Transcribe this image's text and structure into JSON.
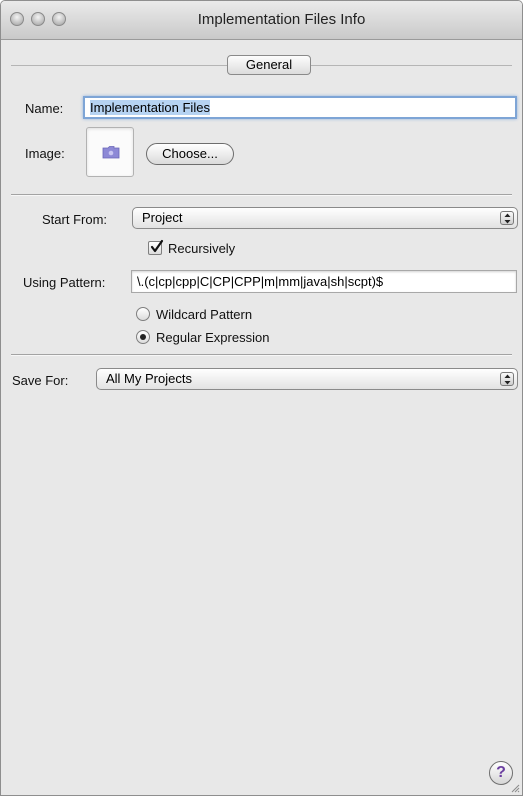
{
  "window": {
    "title": "Implementation Files Info"
  },
  "tabs": {
    "general_label": "General"
  },
  "form": {
    "name_label": "Name:",
    "name_value": "Implementation Files",
    "image_label": "Image:",
    "choose_button": "Choose...",
    "start_from_label": "Start From:",
    "start_from_value": "Project",
    "recursively_label": "Recursively",
    "recursively_checked": true,
    "using_pattern_label": "Using Pattern:",
    "using_pattern_value": "\\.(c|cp|cpp|C|CP|CPP|m|mm|java|sh|scpt)$",
    "wildcard_label": "Wildcard Pattern",
    "regex_label": "Regular Expression",
    "selected_pattern_type": "Regular Expression",
    "save_for_label": "Save For:",
    "save_for_value": "All My Projects"
  },
  "icons": {
    "image_well": "folder-icon",
    "help": "help-icon"
  },
  "help_glyph": "?"
}
